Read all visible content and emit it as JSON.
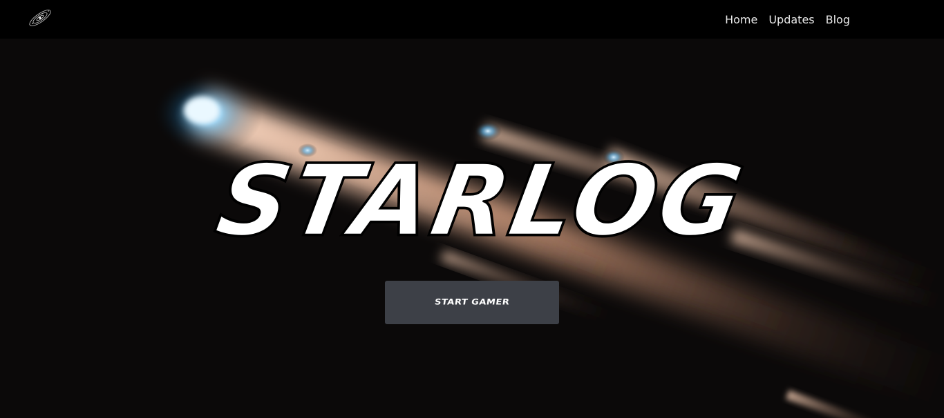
{
  "nav": {
    "logo_icon": "galaxy-icon",
    "links": [
      {
        "label": "Home"
      },
      {
        "label": "Updates"
      },
      {
        "label": "Blog"
      }
    ]
  },
  "hero": {
    "title": "STARLOG",
    "cta_label": "START GAMER",
    "background": "meteor-streaks-image"
  },
  "colors": {
    "navbar_bg": "#000000",
    "page_bg": "#0b0909",
    "button_bg": "#3d4047",
    "text": "#ffffff"
  }
}
